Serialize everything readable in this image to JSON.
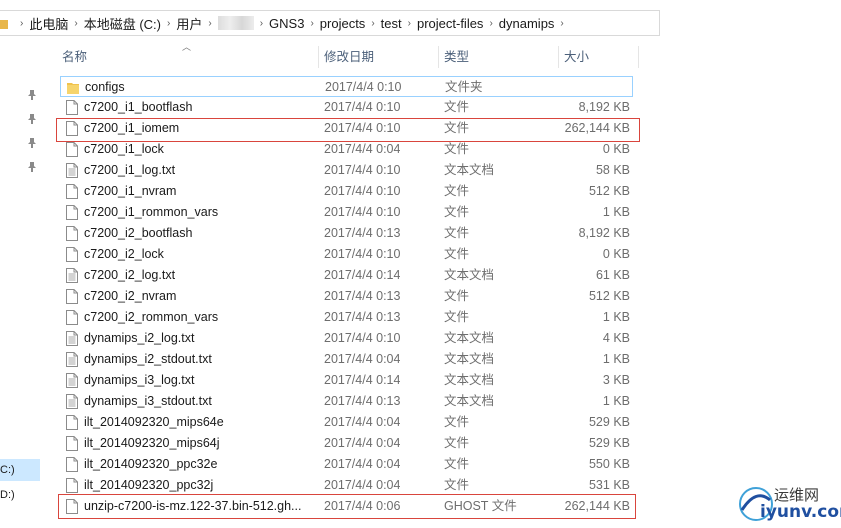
{
  "breadcrumb": {
    "items": [
      "此电脑",
      "本地磁盘 (C:)",
      "用户",
      "",
      "GNS3",
      "projects",
      "test",
      "project-files",
      "dynamips"
    ]
  },
  "nav": {
    "drives": [
      "C:)",
      "D:)"
    ]
  },
  "columns": {
    "name": "名称",
    "date": "修改日期",
    "type": "类型",
    "size": "大小"
  },
  "files": [
    {
      "name": "configs",
      "date": "2017/4/4 0:10",
      "type": "文件夹",
      "size": "",
      "icon": "folder-icon"
    },
    {
      "name": "c7200_i1_bootflash",
      "date": "2017/4/4 0:10",
      "type": "文件",
      "size": "8,192 KB",
      "icon": "file-icon"
    },
    {
      "name": "c7200_i1_iomem",
      "date": "2017/4/4 0:10",
      "type": "文件",
      "size": "262,144 KB",
      "icon": "file-icon"
    },
    {
      "name": "c7200_i1_lock",
      "date": "2017/4/4 0:04",
      "type": "文件",
      "size": "0 KB",
      "icon": "file-icon"
    },
    {
      "name": "c7200_i1_log.txt",
      "date": "2017/4/4 0:10",
      "type": "文本文档",
      "size": "58 KB",
      "icon": "text-file-icon"
    },
    {
      "name": "c7200_i1_nvram",
      "date": "2017/4/4 0:10",
      "type": "文件",
      "size": "512 KB",
      "icon": "file-icon"
    },
    {
      "name": "c7200_i1_rommon_vars",
      "date": "2017/4/4 0:10",
      "type": "文件",
      "size": "1 KB",
      "icon": "file-icon"
    },
    {
      "name": "c7200_i2_bootflash",
      "date": "2017/4/4 0:13",
      "type": "文件",
      "size": "8,192 KB",
      "icon": "file-icon"
    },
    {
      "name": "c7200_i2_lock",
      "date": "2017/4/4 0:10",
      "type": "文件",
      "size": "0 KB",
      "icon": "file-icon"
    },
    {
      "name": "c7200_i2_log.txt",
      "date": "2017/4/4 0:14",
      "type": "文本文档",
      "size": "61 KB",
      "icon": "text-file-icon"
    },
    {
      "name": "c7200_i2_nvram",
      "date": "2017/4/4 0:13",
      "type": "文件",
      "size": "512 KB",
      "icon": "file-icon"
    },
    {
      "name": "c7200_i2_rommon_vars",
      "date": "2017/4/4 0:13",
      "type": "文件",
      "size": "1 KB",
      "icon": "file-icon"
    },
    {
      "name": "dynamips_i2_log.txt",
      "date": "2017/4/4 0:10",
      "type": "文本文档",
      "size": "4 KB",
      "icon": "text-file-icon"
    },
    {
      "name": "dynamips_i2_stdout.txt",
      "date": "2017/4/4 0:04",
      "type": "文本文档",
      "size": "1 KB",
      "icon": "text-file-icon"
    },
    {
      "name": "dynamips_i3_log.txt",
      "date": "2017/4/4 0:14",
      "type": "文本文档",
      "size": "3 KB",
      "icon": "text-file-icon"
    },
    {
      "name": "dynamips_i3_stdout.txt",
      "date": "2017/4/4 0:13",
      "type": "文本文档",
      "size": "1 KB",
      "icon": "text-file-icon"
    },
    {
      "name": "ilt_2014092320_mips64e",
      "date": "2017/4/4 0:04",
      "type": "文件",
      "size": "529 KB",
      "icon": "file-icon"
    },
    {
      "name": "ilt_2014092320_mips64j",
      "date": "2017/4/4 0:04",
      "type": "文件",
      "size": "529 KB",
      "icon": "file-icon"
    },
    {
      "name": "ilt_2014092320_ppc32e",
      "date": "2017/4/4 0:04",
      "type": "文件",
      "size": "550 KB",
      "icon": "file-icon"
    },
    {
      "name": "ilt_2014092320_ppc32j",
      "date": "2017/4/4 0:04",
      "type": "文件",
      "size": "531 KB",
      "icon": "file-icon"
    },
    {
      "name": "unzip-c7200-is-mz.122-37.bin-512.gh...",
      "date": "2017/4/4 0:06",
      "type": "GHOST 文件",
      "size": "262,144 KB",
      "icon": "file-icon"
    }
  ],
  "highlight_color": "#d9453d",
  "watermark": {
    "line1": "运维网",
    "line2": "iyunv.com"
  }
}
